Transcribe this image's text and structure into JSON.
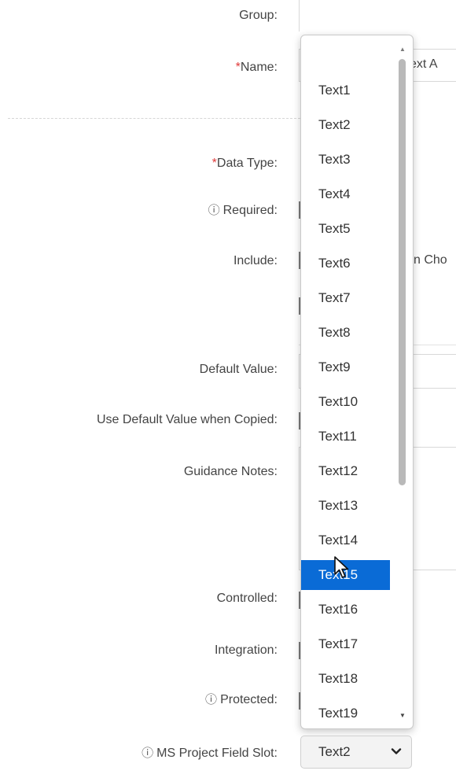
{
  "form": {
    "group_label": "Group:",
    "name_label": "Name:",
    "name_value_partial": "ext A",
    "data_type_label": "Data Type:",
    "required_label": "Required:",
    "include_label": "Include:",
    "include_option_partial": "n Cho",
    "default_value_label": "Default Value:",
    "use_default_copied_label": "Use Default Value when Copied:",
    "guidance_notes_label": "Guidance Notes:",
    "controlled_label": "Controlled:",
    "integration_label": "Integration:",
    "protected_label": "Protected:",
    "ms_project_field_slot_label": "MS Project Field Slot:",
    "required_marker": "*",
    "info_glyph": "ⓘ"
  },
  "field_slot_select": {
    "selected_value": "Text2"
  },
  "dropdown": {
    "options": [
      "Text1",
      "Text2",
      "Text3",
      "Text4",
      "Text5",
      "Text6",
      "Text7",
      "Text8",
      "Text9",
      "Text10",
      "Text11",
      "Text12",
      "Text13",
      "Text14",
      "Text15",
      "Text16",
      "Text17",
      "Text18",
      "Text19"
    ],
    "highlighted_option": "Text15"
  },
  "colors": {
    "highlight": "#0a6bd6",
    "required_marker": "#e03a3a"
  },
  "icons": {
    "info": "info-icon",
    "chevron": "chevron-down-icon",
    "cursor": "mouse-pointer-icon"
  }
}
